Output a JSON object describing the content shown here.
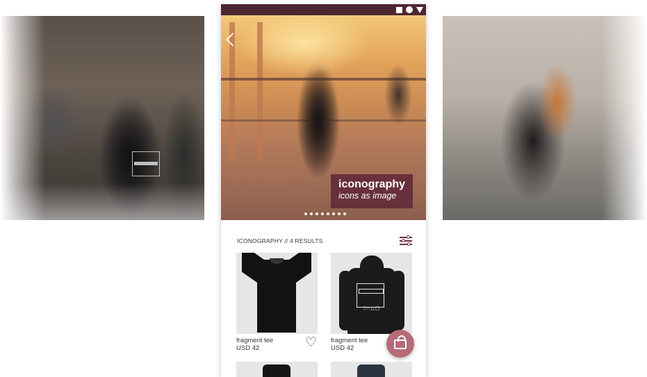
{
  "hero": {
    "caption_title": "iconography",
    "caption_subtitle": "icons as image",
    "carousel_dots": 8
  },
  "results": {
    "label": "ICONOGRAPHY // 4 RESULTS"
  },
  "products": [
    {
      "name": "fragment tee",
      "price": "USD  42"
    },
    {
      "name": "fragment tee",
      "price": "USD  42"
    }
  ],
  "colors": {
    "status_bar": "#4e2632",
    "caption_bg": "#632b3a",
    "fab_bg": "#b66b78",
    "accent": "#6b3040"
  },
  "icons": {
    "status": [
      "square-icon",
      "circle-icon",
      "triangle-icon"
    ],
    "back": "chevron-left-icon",
    "filter": "sliders-icon",
    "favorite": "heart-outline-icon",
    "cart": "shopping-bag-icon"
  }
}
